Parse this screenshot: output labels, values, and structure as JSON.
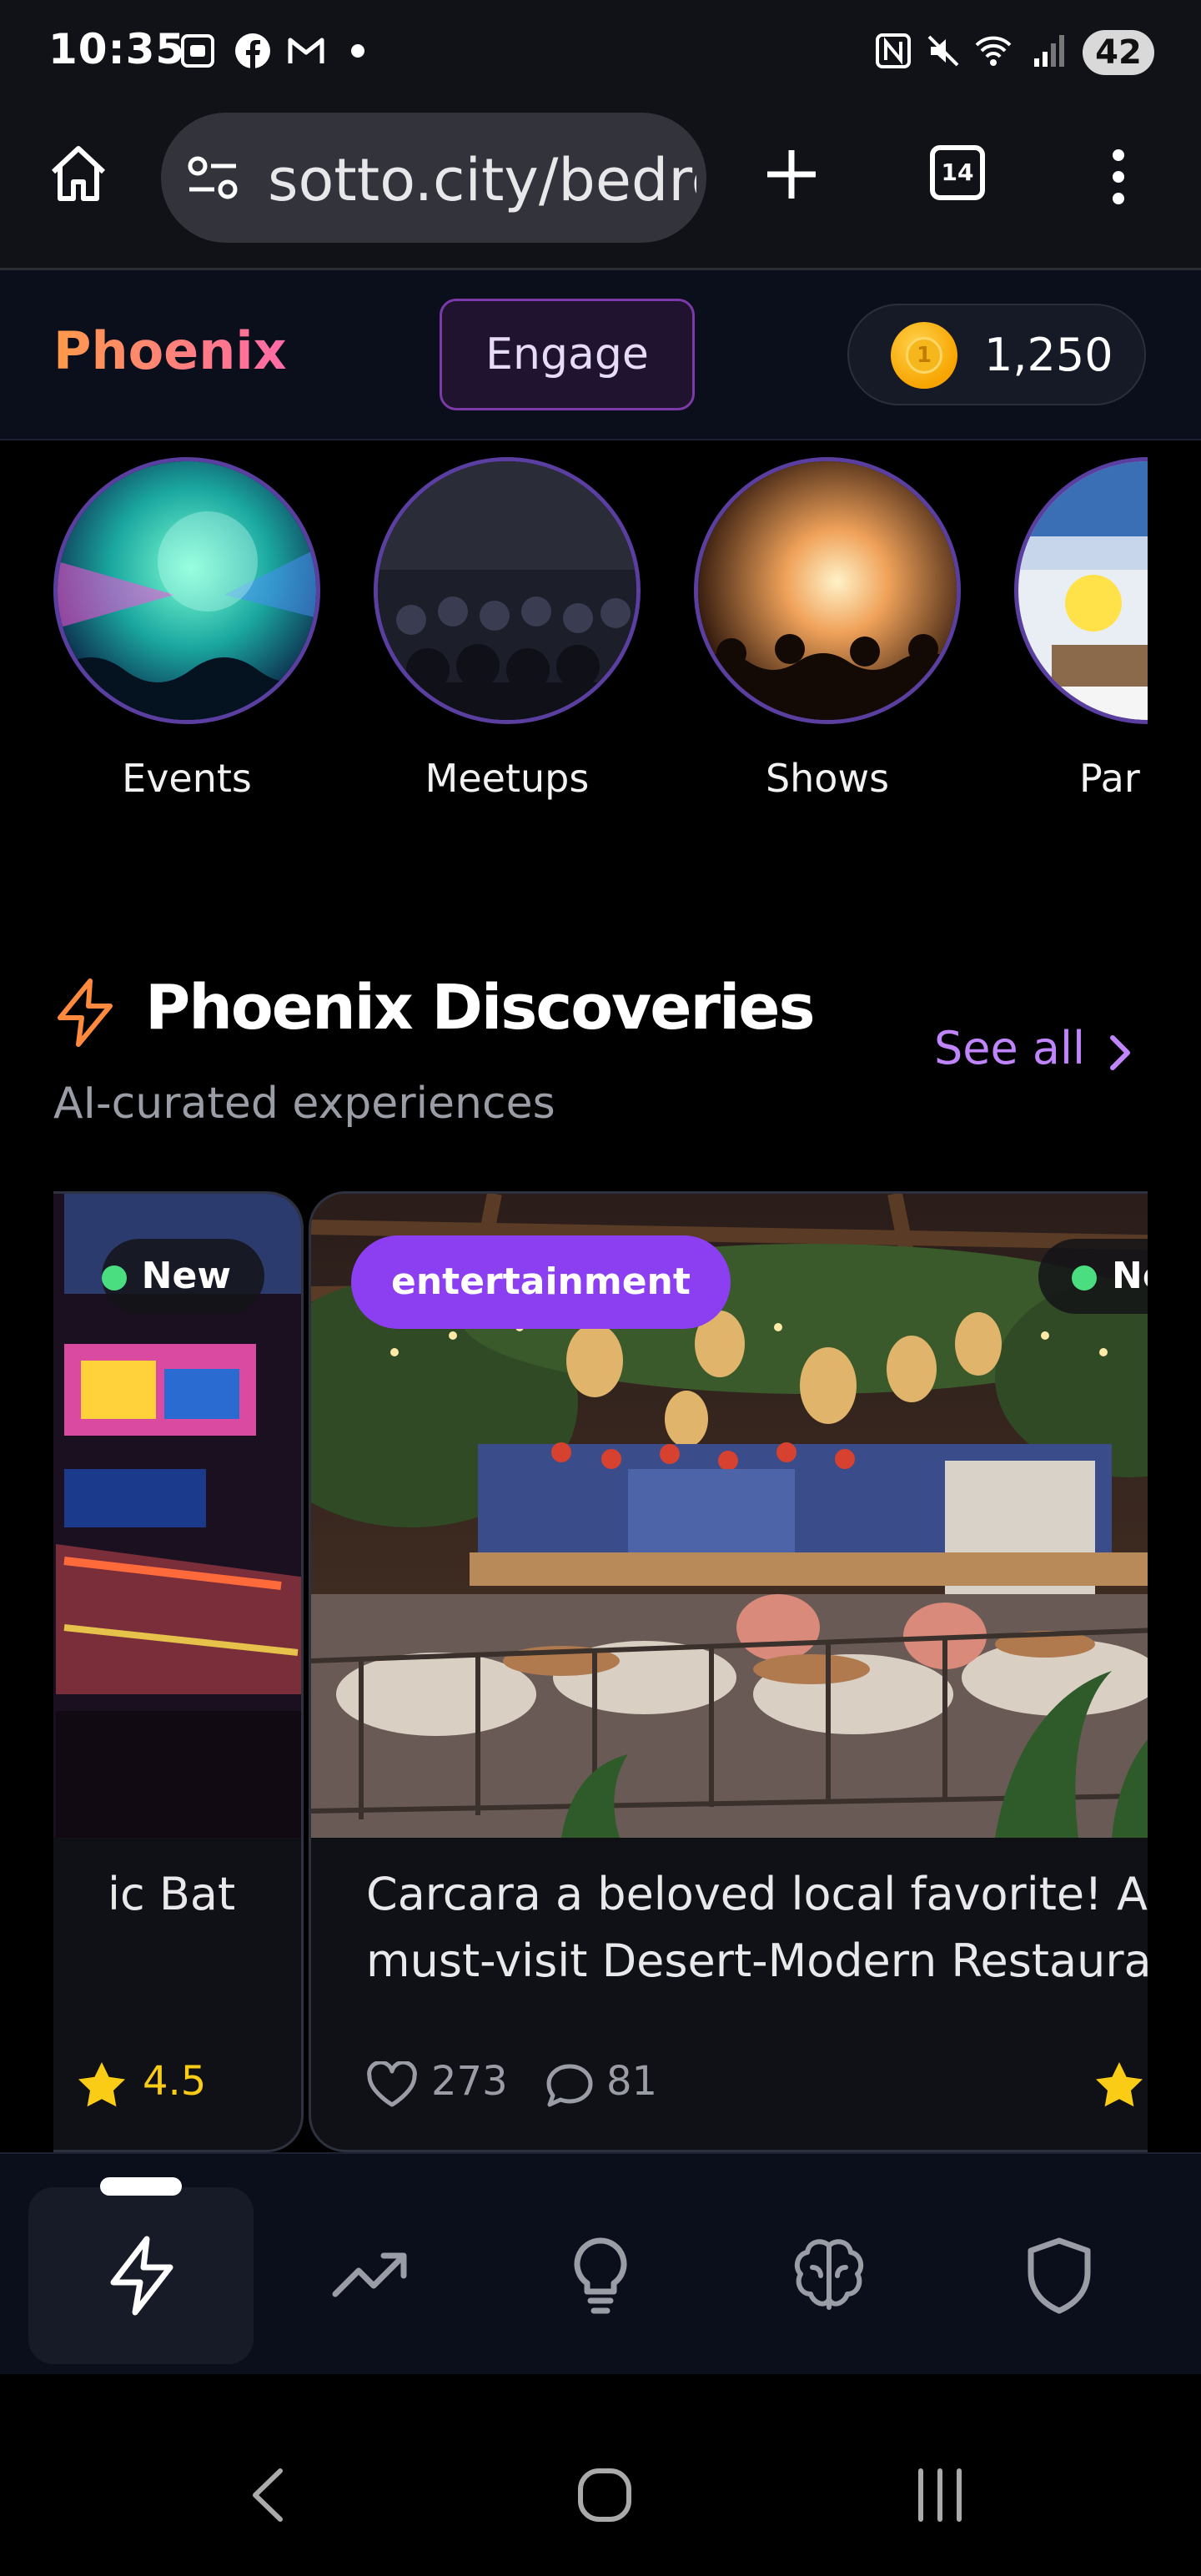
{
  "status_bar": {
    "time": "10:35",
    "battery": "42",
    "icons": [
      "screenshot-icon",
      "facebook-icon",
      "gmail-icon",
      "dot-icon",
      "nfc-icon",
      "mute-icon",
      "wifi-icon",
      "signal-icon"
    ]
  },
  "browser": {
    "url": "sotto.city/bedrc",
    "tab_count": "14",
    "icons": [
      "home-icon",
      "site-settings-icon",
      "new-tab-icon",
      "tabs-icon",
      "more-icon"
    ]
  },
  "header": {
    "brand": "Phoenix",
    "engage_label": "Engage",
    "coins": "1,250",
    "colors": {
      "brand_from": "#ff9a4a",
      "brand_to": "#ff6aa8",
      "accent": "#c084fc"
    }
  },
  "categories": [
    {
      "label": "Events"
    },
    {
      "label": "Meetups"
    },
    {
      "label": "Shows"
    },
    {
      "label": "Par"
    }
  ],
  "discoveries": {
    "title": "Phoenix Discoveries",
    "subtitle": "AI-curated experiences",
    "see_all": "See all",
    "cards": [
      {
        "badge": "New",
        "title_line1": "ic Bat",
        "rating": "4.5"
      },
      {
        "category": "entertainment",
        "badge": "Ne",
        "title_line1": "Carcara a beloved local favorite! A",
        "title_line2": "must-visit Desert-Modern Restaura",
        "likes": "273",
        "comments": "81"
      }
    ]
  },
  "bottom_nav": {
    "items": [
      "lightning-icon",
      "trending-icon",
      "lightbulb-icon",
      "brain-icon",
      "shield-icon"
    ],
    "active": "lightning-icon"
  },
  "android_nav": [
    "back-icon",
    "home-circle-icon",
    "recents-icon"
  ]
}
